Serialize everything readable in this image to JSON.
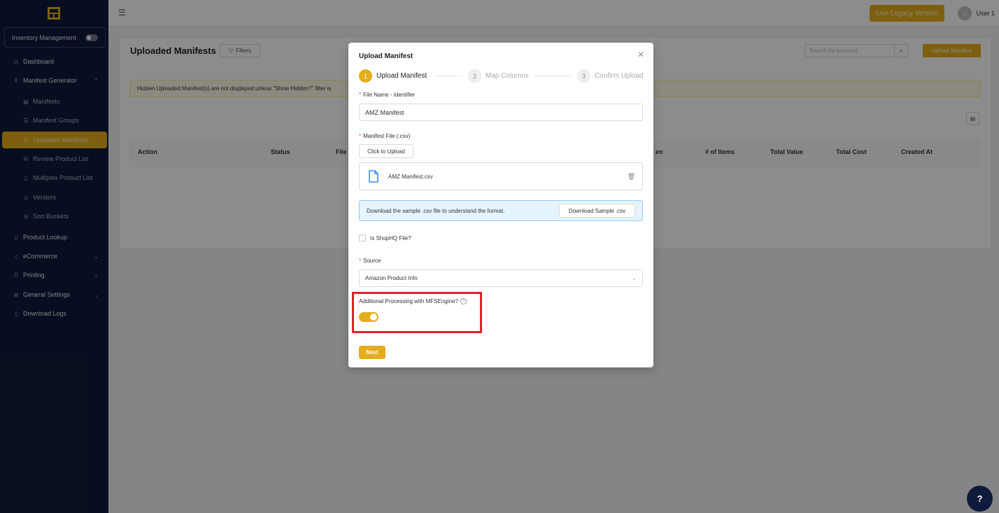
{
  "sidebar": {
    "inventory_label": "Inventory Management",
    "items": [
      {
        "label": "Dashboard",
        "icon": "dashboard-icon"
      },
      {
        "label": "Manifest Generator",
        "icon": "sitemap-icon"
      },
      {
        "label": "Manifests",
        "icon": "manifest-icon"
      },
      {
        "label": "Manifest Groups",
        "icon": "groups-icon"
      },
      {
        "label": "Uploaded Manifests",
        "icon": "file-icon"
      },
      {
        "label": "Review Product List",
        "icon": "percent-icon"
      },
      {
        "label": "Multiples Product List",
        "icon": "file-icon"
      },
      {
        "label": "Vendors",
        "icon": "cart-icon"
      },
      {
        "label": "Sort Buckets",
        "icon": "bucket-icon"
      },
      {
        "label": "Product Lookup",
        "icon": "file-icon"
      },
      {
        "label": "eCommerce",
        "icon": "shop-icon"
      },
      {
        "label": "Printing",
        "icon": "printer-icon"
      },
      {
        "label": "General Settings",
        "icon": "settings-icon"
      },
      {
        "label": "Download Logs",
        "icon": "file-icon"
      }
    ]
  },
  "header": {
    "legacy_label": "Use Legacy Version",
    "user_initial": "U",
    "user_name": "User 1"
  },
  "main": {
    "title": "Uploaded Manifests",
    "filters_label": "Filters",
    "search_placeholder": "Search for keyword",
    "upload_label": "Upload Manifest",
    "notice": "Hidden Uploaded Manifest(s) are not displayed unless \"Show Hidden?\" filter is",
    "columns": [
      "Action",
      "Status",
      "File I",
      "en",
      "# of Items",
      "Total Value",
      "Total Cost",
      "Created At"
    ]
  },
  "modal": {
    "title": "Upload Manifest",
    "steps": [
      {
        "num": "1",
        "label": "Upload Manifest"
      },
      {
        "num": "2",
        "label": "Map Columns"
      },
      {
        "num": "3",
        "label": "Confirm Upload"
      }
    ],
    "file_name_label": "File Name - Identifier",
    "file_name_value": "AMZ Manifest",
    "manifest_file_label": "Manifest File (.csv)",
    "click_upload_label": "Click to Upload",
    "uploaded_file": "AMZ Manifest.csv",
    "info_text": "Download the sample .csv file to understand the format.",
    "download_sample_label": "Download Sample .csv",
    "shophq_label": "Is ShopHQ File?",
    "source_label": "Source",
    "source_value": "Amazon Product Info",
    "processing_label": "Additional Processing with MFSEngine?",
    "processing_enabled": true,
    "next_label": "Next"
  },
  "colors": {
    "accent": "#e3ad1d",
    "sidebar_bg": "#0f1b3d",
    "highlight": "#e02028"
  }
}
